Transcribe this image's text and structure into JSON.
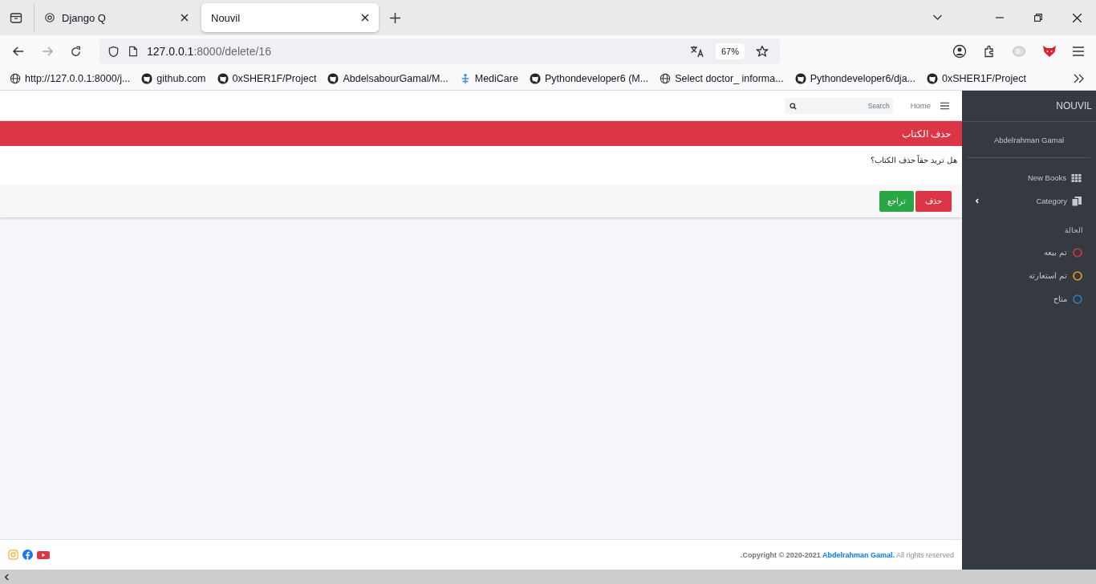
{
  "browser": {
    "tabs": [
      {
        "title": "Django Q",
        "selected": false
      },
      {
        "title": "Nouvil",
        "selected": true
      }
    ],
    "url_host": "127.0.0.1",
    "url_path": ":8000/delete/16",
    "zoom": "67%",
    "bookmarks": [
      {
        "kind": "globe",
        "label": "http://127.0.0.1:8000/j..."
      },
      {
        "kind": "github",
        "label": "github.com"
      },
      {
        "kind": "github",
        "label": "0xSHER1F/Project"
      },
      {
        "kind": "github",
        "label": "AbdelsabourGamal/M..."
      },
      {
        "kind": "medical",
        "label": "MediCare"
      },
      {
        "kind": "github",
        "label": "Pythondeveloper6 (M..."
      },
      {
        "kind": "globe",
        "label": "Select doctor_ informa..."
      },
      {
        "kind": "github",
        "label": "Pythondeveloper6/dja..."
      },
      {
        "kind": "github",
        "label": "0xSHER1F/Project"
      }
    ]
  },
  "navbar": {
    "home": "Home",
    "search": {
      "placeholder": "Search"
    }
  },
  "card": {
    "title": "حذف الكتاب",
    "question": "هل تريد حقاً حذف الكتاب؟",
    "buttons": [
      {
        "kind": "danger",
        "label": "حذف"
      },
      {
        "kind": "success",
        "label": "تراجع"
      }
    ]
  },
  "footer": {
    "copyright": ".Copyright © 2020-2021 ",
    "author": "Abdelrahman Gamal.",
    "rights": " All rights reserved"
  },
  "sidebar": {
    "brand": "NOUVIL",
    "user": "Abdelrahman Gamal",
    "menu": [
      {
        "kind": "grid",
        "label": "New Books",
        "expandable": false
      },
      {
        "kind": "pages",
        "label": "Category",
        "expandable": true
      }
    ],
    "status_heading": "الحالة",
    "statuses": [
      {
        "label": "تم بيعه",
        "color": "#dc3545"
      },
      {
        "label": "تم استعارته",
        "color": "#f39c33"
      },
      {
        "label": "متاح",
        "color": "#2f7fc1"
      }
    ]
  }
}
